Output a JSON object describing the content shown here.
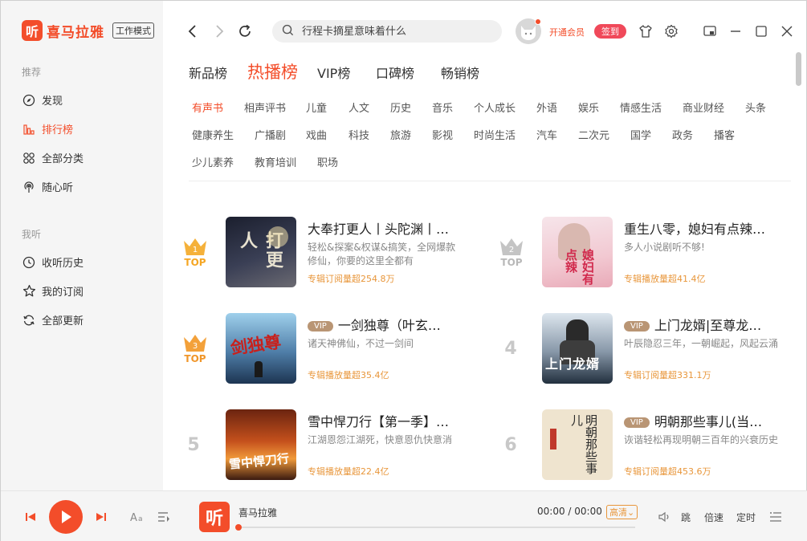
{
  "app": {
    "name": "喜马拉雅",
    "logo_char": "听",
    "mode": "工作模式"
  },
  "sidebar": {
    "section1": "推荐",
    "items1": [
      {
        "label": "发现",
        "icon": "compass-icon"
      },
      {
        "label": "排行榜",
        "icon": "chart-icon",
        "active": true
      },
      {
        "label": "全部分类",
        "icon": "grid-icon"
      },
      {
        "label": "随心听",
        "icon": "radio-icon"
      }
    ],
    "section2": "我听",
    "items2": [
      {
        "label": "收听历史",
        "icon": "clock-icon"
      },
      {
        "label": "我的订阅",
        "icon": "star-icon"
      },
      {
        "label": "全部更新",
        "icon": "refresh-icon"
      }
    ]
  },
  "topbar": {
    "search_placeholder": "行程卡摘星意味着什么",
    "vip_link": "开通会员",
    "signin": "签到"
  },
  "rank_tabs": [
    "新品榜",
    "热播榜",
    "VIP榜",
    "口碑榜",
    "畅销榜"
  ],
  "active_rank_tab": 1,
  "categories": [
    [
      "有声书",
      "相声评书",
      "儿童",
      "人文",
      "历史",
      "音乐",
      "个人成长",
      "外语",
      "娱乐",
      "情感生活",
      "商业财经",
      "头条"
    ],
    [
      "健康养生",
      "广播剧",
      "戏曲",
      "科技",
      "旅游",
      "影视",
      "时尚生活",
      "汽车",
      "二次元",
      "国学",
      "政务",
      "播客"
    ],
    [
      "少儿素养",
      "教育培训",
      "职场"
    ]
  ],
  "books": [
    {
      "rank": "1",
      "top": "TOP",
      "vip": "",
      "title": "大奉打更人丨头陀渊丨…",
      "desc": "轻松&探案&权谋&搞笑，全网爆款修仙，你要的这里全都有",
      "stat": "专辑订阅量超254.8万",
      "cover_text": "打更人"
    },
    {
      "rank": "2",
      "top": "TOP",
      "vip": "",
      "title": "重生八零，媳妇有点辣…",
      "desc": "多人小说剧听不够!",
      "stat": "专辑播放量超41.4亿",
      "cover_text": "媳妇有点辣"
    },
    {
      "rank": "3",
      "top": "TOP",
      "vip": "VIP",
      "title": "一剑独尊（叶玄…",
      "desc": "诸天神佛仙，不过一剑间",
      "stat": "专辑播放量超35.4亿",
      "cover_text": "剑独尊"
    },
    {
      "rank": "4",
      "top": "",
      "vip": "VIP",
      "title": "上门龙婿|至尊龙…",
      "desc": "叶辰隐忍三年，一朝崛起，风起云涌",
      "stat": "专辑订阅量超331.1万",
      "cover_text": "上门龙婿"
    },
    {
      "rank": "5",
      "top": "",
      "vip": "",
      "title": "雪中悍刀行【第一季】…",
      "desc": "江湖恩怨江湖死，快意恩仇快意消",
      "stat": "专辑播放量超22.4亿",
      "cover_text": "雪中悍刀行"
    },
    {
      "rank": "6",
      "top": "",
      "vip": "VIP",
      "title": "明朝那些事儿(当…",
      "desc": "诙谐轻松再现明朝三百年的兴衰历史",
      "stat": "专辑订阅量超453.6万",
      "cover_text": "明朝那些事儿"
    }
  ],
  "player": {
    "title": "喜马拉雅",
    "time": "00:00 / 00:00",
    "quality": "高清",
    "skip": "跳",
    "speed": "倍速",
    "timer": "定时",
    "progress": 0
  },
  "colors": {
    "accent": "#f34d2a",
    "gold": "#f5a623",
    "silver": "#b8b8b8"
  }
}
